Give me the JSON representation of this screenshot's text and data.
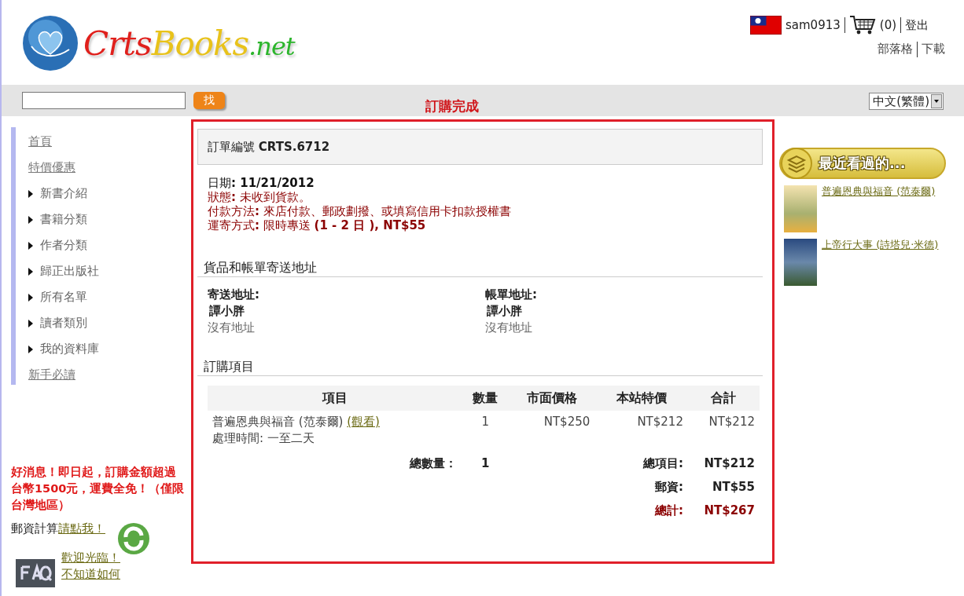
{
  "logo": {
    "part_1": "Crts",
    "part_2": "Books",
    "part_3": ".net"
  },
  "user_bar": {
    "username": "sam0913",
    "cart_count": "(0)",
    "logout": "登出",
    "links": [
      "部落格",
      "下載"
    ]
  },
  "search": {
    "button": "找"
  },
  "page_title": "訂購完成",
  "language": {
    "value": "中文(繁體)"
  },
  "sidebar": {
    "items": [
      {
        "label": "首頁",
        "kind": "link"
      },
      {
        "label": "特價優惠",
        "kind": "link"
      },
      {
        "label": "新書介紹",
        "kind": "menu"
      },
      {
        "label": "書籍分類",
        "kind": "menu"
      },
      {
        "label": "作者分類",
        "kind": "menu"
      },
      {
        "label": "歸正出版社",
        "kind": "menu"
      },
      {
        "label": "所有名單",
        "kind": "menu"
      },
      {
        "label": "讀者類別",
        "kind": "menu"
      },
      {
        "label": "我的資料庫",
        "kind": "menu"
      },
      {
        "label": "新手必讀",
        "kind": "link"
      }
    ],
    "promo": "好消息！即日起，訂購金額超過台幣**1500**元，運費全免！（僅限台灣地區）",
    "postage_label": "郵資計算",
    "postage_link": "請點我！",
    "faq_lines": [
      "歡迎光臨！",
      "不知道如何"
    ]
  },
  "order": {
    "title": "訂單編號 **CRTS.6712**",
    "info": [
      {
        "text": "日期**: 11/21/2012**",
        "color": "#111111"
      },
      {
        "text": "狀態**:** 未收到貨款。",
        "color": "#8b0000"
      },
      {
        "text": "付款方法**:** 來店付款、郵政劃撥、或填寫信用卡扣款授權書",
        "color": "#8b0000"
      },
      {
        "text": "運寄方式**:** 限時專送 **(1 - 2 日 ), NT$55**",
        "color": "#8b0000"
      }
    ],
    "address_heading": "貨品和帳單寄送地址",
    "addresses": [
      {
        "label": "寄送地址:",
        "name": "譚小胖",
        "address": "沒有地址"
      },
      {
        "label": "帳單地址:",
        "name": "譚小胖",
        "address": "沒有地址"
      }
    ],
    "items_heading": "訂購項目",
    "table": {
      "columns": [
        "項目",
        "數量",
        "市面價格",
        "本站特價",
        "合計"
      ],
      "rows": [
        {
          "title": "普遍恩典與福音 (范泰爾)",
          "link": "(觀看)",
          "note": "處理時間: 一至二天",
          "qty": "1",
          "list_price": "NT$250",
          "price": "NT$212",
          "total": "NT$212"
        }
      ]
    },
    "quantity_label": "總數量：",
    "quantity_value": "1",
    "totals": [
      {
        "label": "總項目:",
        "value": "NT$212",
        "highlight": false
      },
      {
        "label": "郵資:",
        "value": "NT$55",
        "highlight": false
      },
      {
        "label": "總計:",
        "value": "NT$267",
        "highlight": true
      }
    ]
  },
  "recent": {
    "heading": "最近看過的...",
    "items": [
      "普遍恩典與福音 (范泰爾)",
      "上帝行大事 (詩塔兒·米德)"
    ]
  }
}
